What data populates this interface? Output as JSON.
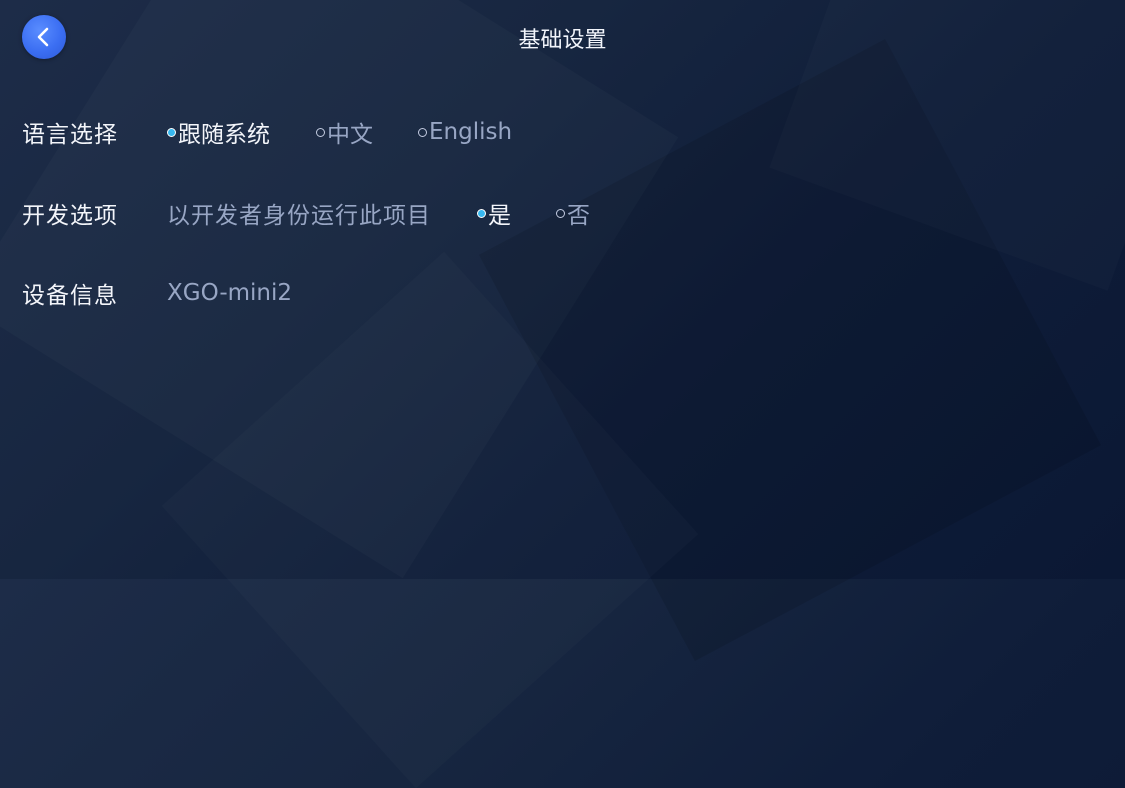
{
  "header": {
    "title": "基础设置",
    "back_icon": "chevron-left-icon"
  },
  "settings": {
    "language": {
      "label": "语言选择",
      "options": [
        {
          "label": "跟随系统",
          "selected": true
        },
        {
          "label": "中文",
          "selected": false
        },
        {
          "label": "English",
          "selected": false
        }
      ]
    },
    "developer": {
      "label": "开发选项",
      "description": "以开发者身份运行此项目",
      "options": [
        {
          "label": "是",
          "selected": true
        },
        {
          "label": "否",
          "selected": false
        }
      ]
    },
    "device": {
      "label": "设备信息",
      "value": "XGO-mini2"
    }
  },
  "colors": {
    "accent": "#37b8f0",
    "back_button": "#3b6ef2",
    "text_primary": "#f3f5fa",
    "text_secondary": "#98a6c4",
    "background": "#132241"
  }
}
